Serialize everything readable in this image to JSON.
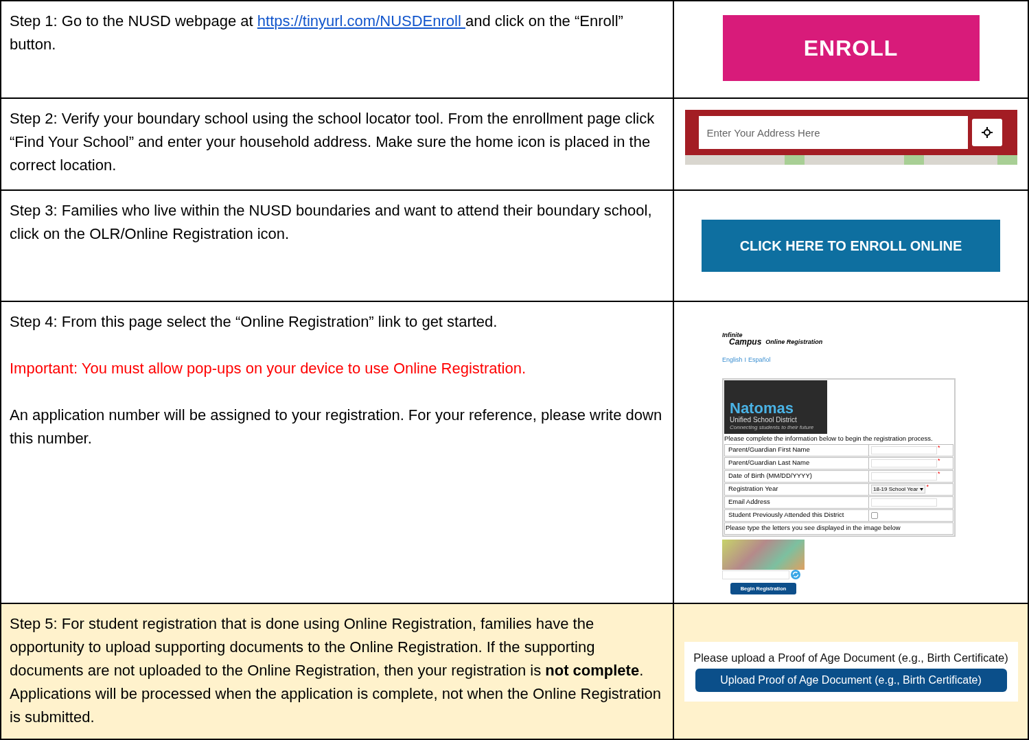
{
  "steps": [
    {
      "label": "Step 1:",
      "highlighted": false,
      "paragraphs": [
        {
          "kind": "link_text",
          "before": " Go to the NUSD webpage at ",
          "link": "https://tinyurl.com/NUSDEnroll ",
          "after": "and click on the “Enroll” button."
        }
      ],
      "illustration": {
        "kind": "enroll_button",
        "label": "ENROLL"
      }
    },
    {
      "label": "Step 2:",
      "highlighted": false,
      "paragraphs": [
        {
          "kind": "text",
          "text": " Verify your boundary school using the school locator tool.  From the enrollment page click “Find Your School” and enter your household address.  Make sure the home icon is placed in the correct location."
        }
      ],
      "illustration": {
        "kind": "address_search",
        "placeholder": "Enter Your Address Here"
      }
    },
    {
      "label": "Step 3:",
      "highlighted": false,
      "paragraphs": [
        {
          "kind": "text",
          "text": " Families who live within the NUSD boundaries and want to attend their boundary school, click on the OLR/Online Registration icon."
        }
      ],
      "illustration": {
        "kind": "online_button",
        "label": "CLICK HERE TO ENROLL ONLINE"
      }
    },
    {
      "label": "Step 4:",
      "highlighted": false,
      "paragraphs": [
        {
          "kind": "text",
          "text": " From this page select the “Online Registration” link to get started."
        },
        {
          "kind": "important",
          "text": "Important: You must allow pop-ups on your device to use Online Registration."
        },
        {
          "kind": "plain",
          "text": "An application number will be assigned to your registration.  For your reference, please write down this number."
        }
      ],
      "illustration": {
        "kind": "registration_form",
        "brand_top": "Infinite",
        "brand_bottom": "Campus",
        "brand_title": "Online Registration",
        "languages": [
          {
            "label": "English",
            "selected": false
          },
          {
            "label": "Español",
            "selected": false
          }
        ],
        "separator": "I",
        "logo": {
          "name": "Natomas",
          "subtitle": "Unified School District",
          "tagline": "Connecting students to their future"
        },
        "intro": "Please complete the information below to begin the registration process.",
        "fields": [
          {
            "label": "Parent/Guardian First Name",
            "kind": "text",
            "required_mark": "*"
          },
          {
            "label": "Parent/Guardian Last Name",
            "kind": "text",
            "required_mark": "*"
          },
          {
            "label": "Date of Birth (MM/DD/YYYY)",
            "kind": "text",
            "required_mark": "*"
          },
          {
            "label": "Registration Year",
            "kind": "select",
            "value": "18-19 School Year",
            "required_mark": "*"
          },
          {
            "label": "Email Address",
            "kind": "text"
          },
          {
            "label": "Student Previously Attended this District",
            "kind": "checkbox",
            "checked": false
          }
        ],
        "captcha_prompt": "Please type the letters you see displayed in the image below",
        "submit": "Begin Registration"
      }
    },
    {
      "label": "Step 5:",
      "highlighted": true,
      "paragraphs": [
        {
          "kind": "text",
          "text": " For student registration that is done using Online Registration, families have the opportunity to upload supporting documents to the Online Registration.  If the supporting documents are not uploaded to the Online Registration, then your registration is **not complete**.  Applications will be processed when the application is complete, not when the Online Registration is submitted."
        }
      ],
      "illustration": {
        "kind": "upload_document",
        "prompt": "Please upload a Proof of Age Document (e.g., Birth Certificate)",
        "button": "Upload Proof of Age Document (e.g., Birth Certificate)"
      }
    }
  ]
}
